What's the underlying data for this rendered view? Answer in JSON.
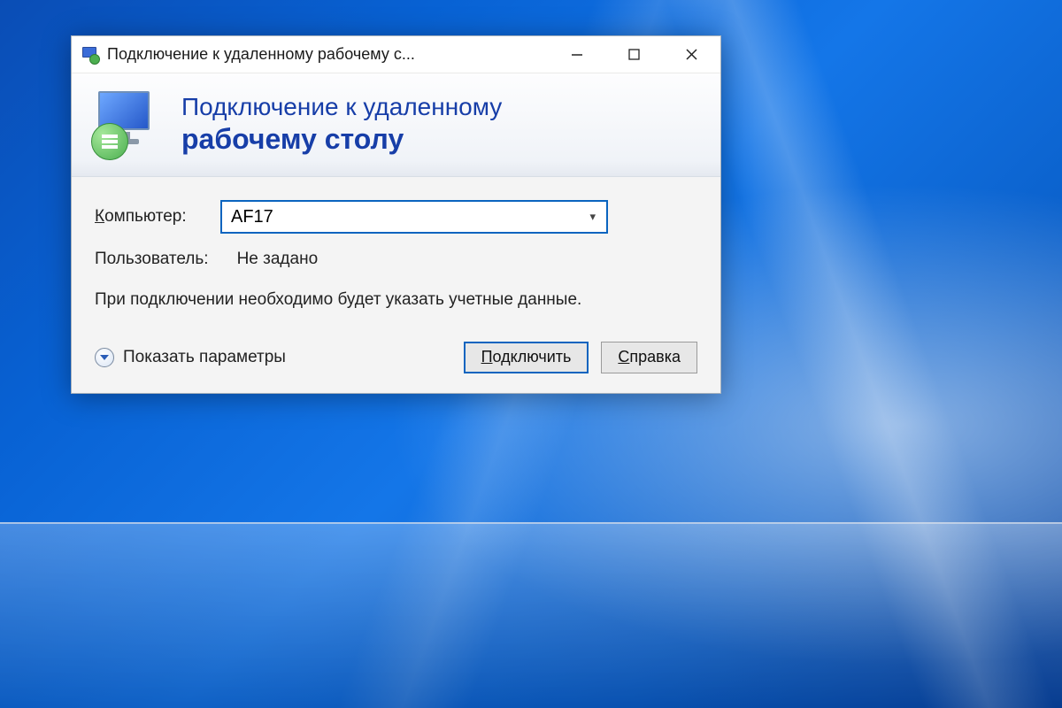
{
  "titlebar": {
    "text": "Подключение к удаленному рабочему с..."
  },
  "banner": {
    "line1": "Подключение к удаленному",
    "line2": "рабочему столу"
  },
  "fields": {
    "computer_label_pre": "К",
    "computer_label_rest": "омпьютер:",
    "computer_value": "AF17",
    "user_label": "Пользователь:",
    "user_value": "Не задано"
  },
  "info": "При подключении необходимо будет указать учетные данные.",
  "footer": {
    "show_options": "Показать параметры",
    "connect_pre": "П",
    "connect_rest": "одключить",
    "help_pre": "С",
    "help_rest": "правка"
  }
}
